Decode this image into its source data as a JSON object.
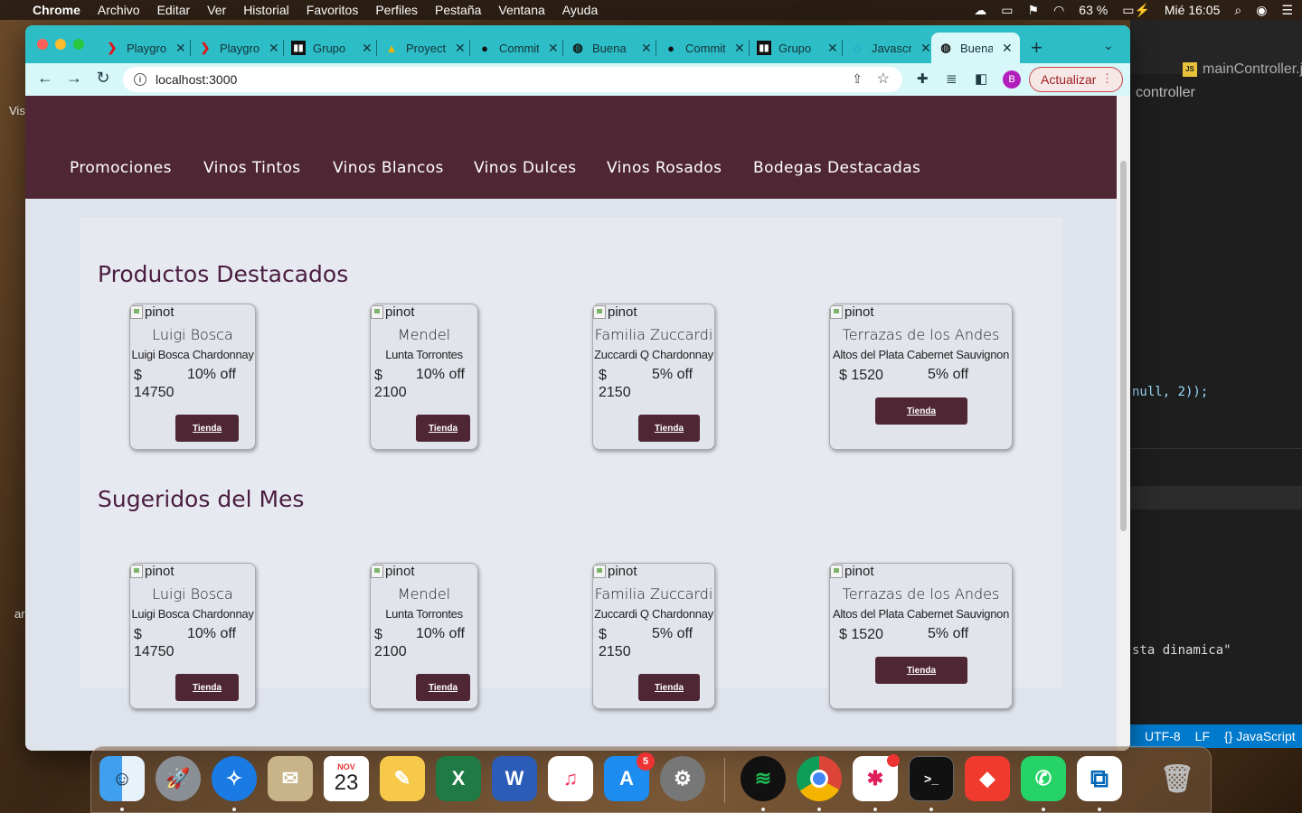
{
  "menubar": {
    "app": "Chrome",
    "items": [
      "Archivo",
      "Editar",
      "Ver",
      "Historial",
      "Favoritos",
      "Perfiles",
      "Pestaña",
      "Ventana",
      "Ayuda"
    ],
    "battery": "63 %",
    "clock": "Mié 16:05"
  },
  "browser": {
    "tabs": [
      {
        "title": "Playground"
      },
      {
        "title": "Playground"
      },
      {
        "title": "Grupo"
      },
      {
        "title": "Proyecto"
      },
      {
        "title": "Commits"
      },
      {
        "title": "Buena"
      },
      {
        "title": "Commits"
      },
      {
        "title": "Grupo"
      },
      {
        "title": "Javascript"
      },
      {
        "title": "Buena"
      }
    ],
    "url": "localhost:3000",
    "profile_initial": "B",
    "update_label": "Actualizar"
  },
  "site": {
    "nav": [
      "Promociones",
      "Vinos Tintos",
      "Vinos Blancos",
      "Vinos Dulces",
      "Vinos Rosados",
      "Bodegas Destacadas"
    ],
    "featured_title": "Productos Destacados",
    "suggested_title": "Sugeridos del Mes",
    "img_alt": "pinot",
    "button_label": "Tienda",
    "featured": [
      {
        "brand": "Luigi Bosca",
        "wine": "Luigi Bosca Chardonnay",
        "price": "$ 14750",
        "discount": "10% off"
      },
      {
        "brand": "Mendel",
        "wine": "Lunta Torrontes",
        "price": "$ 2100",
        "discount": "10% off"
      },
      {
        "brand": "Familia Zuccardi",
        "wine": "Zuccardi Q Chardonnay",
        "price": "$ 2150",
        "discount": "5% off"
      },
      {
        "brand": "Terrazas de los Andes",
        "wine": "Altos del Plata Cabernet Sauvignon",
        "price": "$ 1520",
        "discount": "5% off"
      }
    ],
    "suggested": [
      {
        "brand": "Luigi Bosca",
        "wine": "Luigi Bosca Chardonnay",
        "price": "$ 14750",
        "discount": "10% off"
      },
      {
        "brand": "Mendel",
        "wine": "Lunta Torrontes",
        "price": "$ 2100",
        "discount": "10% off"
      },
      {
        "brand": "Familia Zuccardi",
        "wine": "Zuccardi Q Chardonnay",
        "price": "$ 2150",
        "discount": "5% off"
      },
      {
        "brand": "Terrazas de los Andes",
        "wine": "Altos del Plata Cabernet Sauvignon",
        "price": "$ 1520",
        "discount": "5% off"
      }
    ]
  },
  "editor": {
    "tab": "mainController.js",
    "breadcrumb": "controller",
    "code_line_1": "null, 2));",
    "code_line_2": "sta dinamica\"",
    "status": [
      "UTF-8",
      "LF",
      "{} JavaScript"
    ]
  },
  "left_edge": {
    "text_1": "Vis",
    "text_2": "ar"
  },
  "dock": {
    "calendar_month": "NOV",
    "calendar_day": "23",
    "appstore_badge": "5"
  }
}
